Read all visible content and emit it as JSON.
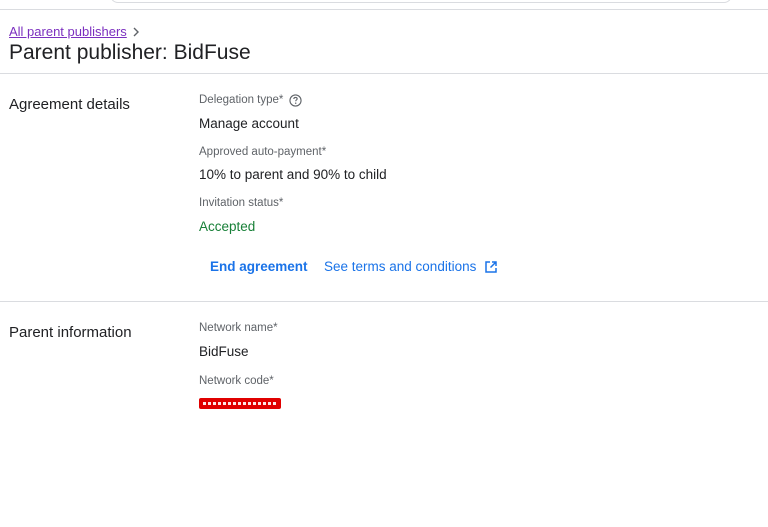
{
  "breadcrumb": {
    "parent_link": "All parent publishers"
  },
  "page_title": "Parent publisher: BidFuse",
  "agreement_details": {
    "section_title": "Agreement details",
    "delegation_type": {
      "label": "Delegation type*",
      "value": "Manage account",
      "icon": "help-icon"
    },
    "auto_payment": {
      "label": "Approved auto-payment*",
      "value": "10% to parent and 90% to child"
    },
    "invitation_status": {
      "label": "Invitation status*",
      "value": "Accepted",
      "color": "#188038"
    },
    "actions": {
      "end_agreement": "End agreement",
      "see_terms": "See terms and conditions",
      "terms_icon": "open-in-new-icon"
    }
  },
  "parent_information": {
    "section_title": "Parent information",
    "network_name": {
      "label": "Network name*",
      "value": "BidFuse"
    },
    "network_code": {
      "label": "Network code*",
      "redacted": true
    }
  },
  "colors": {
    "link_visited": "#7b2fbf",
    "action_blue": "#1a73e8",
    "status_green": "#188038",
    "redaction_red": "#e00000"
  }
}
